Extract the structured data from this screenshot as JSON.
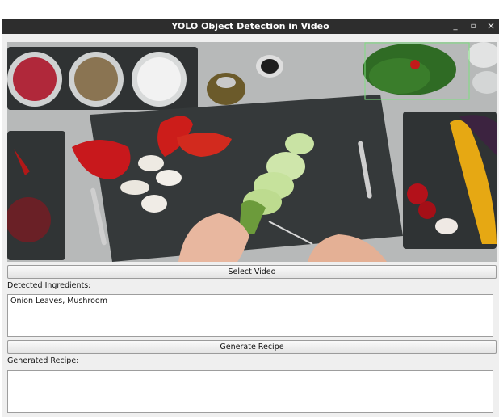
{
  "window": {
    "title": "YOLO Object Detection in Video",
    "controls": {
      "minimize": "_",
      "maximize": "▫",
      "close": "×"
    }
  },
  "video": {
    "detection_box_color": "#7ee07e"
  },
  "buttons": {
    "select_video": "Select Video",
    "generate_recipe": "Generate Recipe"
  },
  "labels": {
    "detected_ingredients": "Detected Ingredients:",
    "generated_recipe": "Generated Recipe:"
  },
  "fields": {
    "detected_ingredients_value": "Onion Leaves, Mushroom",
    "generated_recipe_value": ""
  }
}
